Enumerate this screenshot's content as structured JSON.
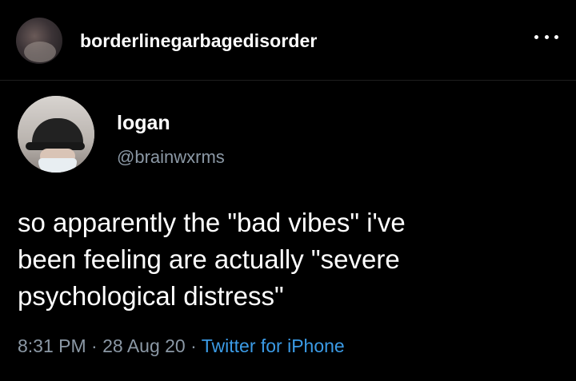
{
  "instagram": {
    "username": "borderlinegarbagedisorder",
    "more_icon": "ellipsis-icon"
  },
  "tweet": {
    "display_name": "logan",
    "handle": "@brainwxrms",
    "text": "so apparently the \"bad vibes\" i've\nbeen feeling are actually \"severe\npsychological distress\"",
    "time": "8:31 PM",
    "date": "28 Aug 20",
    "separator": " · ",
    "source": "Twitter for iPhone"
  },
  "colors": {
    "background": "#000000",
    "text": "#ffffff",
    "secondary": "#8b98a5",
    "link": "#3b9be6"
  }
}
